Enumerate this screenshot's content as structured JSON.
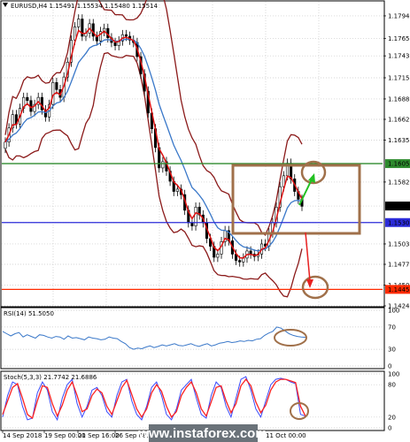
{
  "chart_data": [
    {
      "type": "candlestick",
      "symbol_line": "EURUSD,H4  1.15491 1.15534 1.15480 1.15514",
      "y_ticks": [
        "1.17940",
        "1.17650",
        "1.17430",
        "1.17150",
        "1.16880",
        "1.16620",
        "1.16355",
        "1.16055",
        "1.15820",
        "1.15514",
        "1.15303",
        "1.15030",
        "1.14770",
        "1.14505",
        "1.14450",
        "1.14240"
      ],
      "y_range": [
        1.1424,
        1.1812
      ],
      "grid": true,
      "levels": [
        {
          "label": "1.16055",
          "value": 1.16055,
          "color": "#2e8b2e",
          "highlight": true
        },
        {
          "label": "1.15514",
          "value": 1.15514,
          "color": "#000000",
          "highlight": false
        },
        {
          "label": "1.15303",
          "value": 1.15303,
          "color": "#2b2bd9",
          "highlight": true
        },
        {
          "label": "1.14450",
          "value": 1.1445,
          "color": "#ff2a00",
          "highlight": true
        }
      ],
      "close": [
        1.1633,
        1.1651,
        1.1668,
        1.1656,
        1.1676,
        1.169,
        1.1686,
        1.1672,
        1.1681,
        1.169,
        1.1674,
        1.1665,
        1.1681,
        1.1709,
        1.17,
        1.169,
        1.1716,
        1.1735,
        1.1763,
        1.178,
        1.179,
        1.1768,
        1.1772,
        1.1784,
        1.1768,
        1.1762,
        1.1774,
        1.1778,
        1.1766,
        1.176,
        1.1756,
        1.1762,
        1.177,
        1.1768,
        1.1763,
        1.176,
        1.1742,
        1.172,
        1.1698,
        1.167,
        1.165,
        1.1626,
        1.16,
        1.1608,
        1.1596,
        1.1583,
        1.157,
        1.1573,
        1.1566,
        1.1546,
        1.153,
        1.1526,
        1.155,
        1.154,
        1.153,
        1.151,
        1.15,
        1.1486,
        1.149,
        1.1506,
        1.152,
        1.1507,
        1.149,
        1.1482,
        1.148,
        1.1485,
        1.1494,
        1.149,
        1.1487,
        1.149,
        1.1503,
        1.15,
        1.1517,
        1.153,
        1.155,
        1.1576,
        1.159,
        1.1606,
        1.1586,
        1.157,
        1.156,
        1.1551
      ]
    },
    {
      "type": "line",
      "indicator": "RSI(14) 51.5050",
      "y_ticks": [
        "100",
        "70",
        "30",
        "0"
      ],
      "y_range": [
        0,
        100
      ],
      "values": [
        62,
        58,
        54,
        58,
        60,
        52,
        56,
        53,
        50,
        56,
        55,
        52,
        50,
        53,
        52,
        48,
        54,
        50,
        51,
        49,
        47,
        52,
        50,
        49,
        47,
        48,
        52,
        50,
        49,
        44,
        40,
        33,
        30,
        32,
        31,
        34,
        36,
        33,
        35,
        38,
        36,
        38,
        40,
        37,
        36,
        38,
        40,
        37,
        35,
        38,
        40,
        36,
        38,
        41,
        42,
        44,
        42,
        43,
        45,
        44,
        46,
        45,
        48,
        49,
        55,
        59,
        62,
        70,
        68,
        63,
        58,
        55,
        53,
        52,
        51.505
      ]
    },
    {
      "type": "line",
      "indicator": "Stoch(5,3,3) 21.7742 21.6886",
      "y_ticks": [
        "100",
        "80",
        "20",
        "0"
      ],
      "y_range": [
        0,
        100
      ],
      "series": [
        {
          "name": "21.7742",
          "color": "#3a4aff",
          "values": [
            20,
            60,
            85,
            80,
            40,
            15,
            18,
            65,
            85,
            70,
            30,
            15,
            55,
            80,
            90,
            45,
            20,
            40,
            70,
            75,
            60,
            30,
            20,
            60,
            85,
            90,
            50,
            25,
            15,
            40,
            75,
            85,
            60,
            25,
            15,
            35,
            70,
            80,
            90,
            55,
            25,
            18,
            60,
            85,
            75,
            40,
            20,
            55,
            90,
            95,
            70,
            35,
            20,
            50,
            80,
            90,
            92,
            90,
            85,
            82,
            25,
            21.7742
          ]
        },
        {
          "name": "21.6886",
          "color": "#ff2222",
          "values": [
            25,
            50,
            75,
            82,
            55,
            25,
            18,
            50,
            78,
            75,
            45,
            22,
            42,
            70,
            85,
            60,
            30,
            35,
            60,
            72,
            65,
            40,
            25,
            50,
            75,
            88,
            62,
            35,
            20,
            35,
            65,
            80,
            68,
            40,
            20,
            30,
            60,
            75,
            85,
            65,
            35,
            22,
            48,
            75,
            78,
            50,
            28,
            45,
            78,
            90,
            78,
            48,
            28,
            42,
            70,
            85,
            90,
            90,
            87,
            84,
            40,
            21.6886
          ]
        }
      ]
    }
  ],
  "x_ticks": [
    "14 Sep 2018",
    "19 Sep 00:00",
    "21 Sep 16:00",
    "26 Sep 08:00",
    "11 Oct 00:00"
  ],
  "watermark": "www.instaforex.com",
  "colors": {
    "up": "#ffffff",
    "down": "#000000",
    "bb": "#8b1a1a",
    "ma_fast": "#dd1111",
    "ma_slow": "#3a78c9",
    "annot": "#a0704a",
    "grid": "#c8c8c8"
  }
}
